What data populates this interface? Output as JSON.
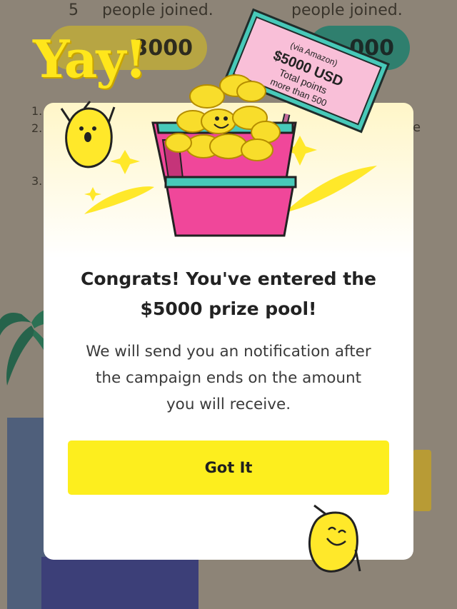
{
  "background": {
    "left_count": "5",
    "left_joined_text": "people joined.",
    "right_joined_text": "people joined.",
    "left_pill_text": "3000",
    "right_pill_text": "000",
    "list_markers": [
      "1.",
      "2.",
      "3."
    ],
    "right_fragment": "e"
  },
  "illustration": {
    "headline": "Yay!",
    "sign": {
      "line1": "(via Amazon)",
      "line2": "$5000 USD",
      "line3": "Total points",
      "line4": "more than 500"
    }
  },
  "modal": {
    "title_line1": "Congrats! You've entered the",
    "title_line2": "$5000 prize pool!",
    "body_line1": "We will send you an notification after",
    "body_line2": "the campaign ends on the amount",
    "body_line3": "you will receive.",
    "button_label": "Got It"
  },
  "colors": {
    "accent_yellow": "#fdee1e",
    "basket_pink": "#f0479a",
    "basket_teal": "#47c9b9",
    "sign_pink": "#f9bfd8",
    "coin_gold": "#f8dd2b",
    "overlay": "#8d8477"
  },
  "icons": [
    "lemon-mascot-icon",
    "coin-icon",
    "sparkle-icon",
    "basket-icon",
    "sign-icon",
    "palm-tree-icon"
  ]
}
